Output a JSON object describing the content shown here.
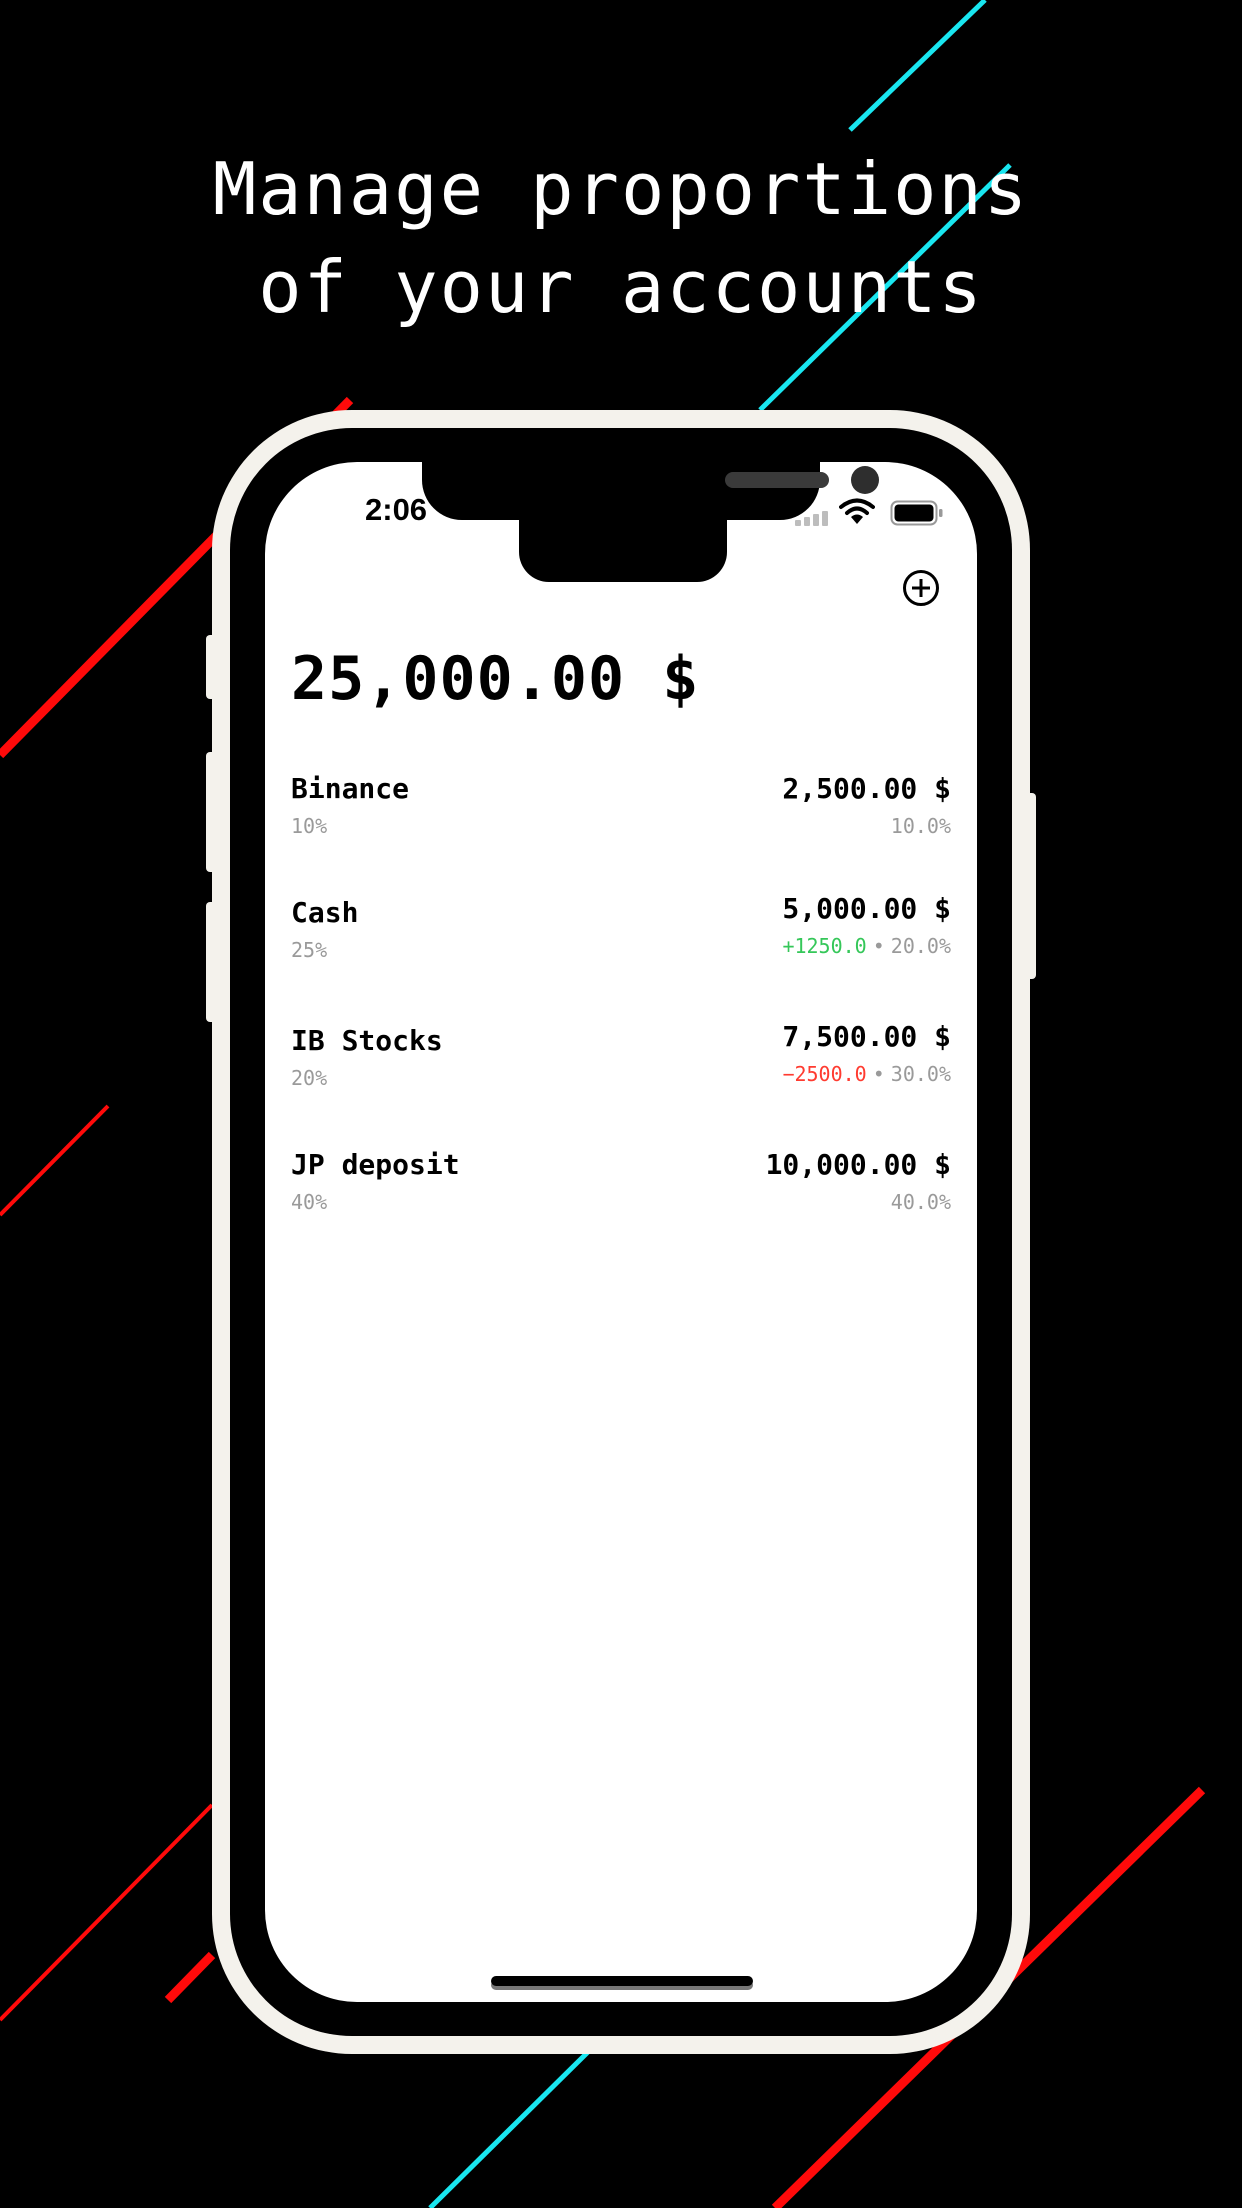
{
  "headline": {
    "line1": "Manage proportions",
    "line2": "of your accounts"
  },
  "colors": {
    "accent_red": "#ff0a0a",
    "accent_cyan": "#19e6f0",
    "frame": "#f4f2ec",
    "positive": "#35c759",
    "negative": "#ff3b30"
  },
  "status_bar": {
    "time": "2:06",
    "icons": [
      "signal-icon",
      "wifi-icon",
      "battery-icon"
    ]
  },
  "toolbar": {
    "add_icon": "plus-circle-icon"
  },
  "portfolio": {
    "total": "25,000.00 $"
  },
  "accounts": [
    {
      "name": "Binance",
      "target": "10%",
      "amount": "2,500.00 $",
      "delta": "",
      "actual": "10.0%"
    },
    {
      "name": "Cash",
      "target": "25%",
      "amount": "5,000.00 $",
      "delta": "+1250.0",
      "actual": "20.0%"
    },
    {
      "name": "IB Stocks",
      "target": "20%",
      "amount": "7,500.00 $",
      "delta": "−2500.0",
      "actual": "30.0%"
    },
    {
      "name": "JP deposit",
      "target": "40%",
      "amount": "10,000.00 $",
      "delta": "",
      "actual": "40.0%"
    }
  ]
}
